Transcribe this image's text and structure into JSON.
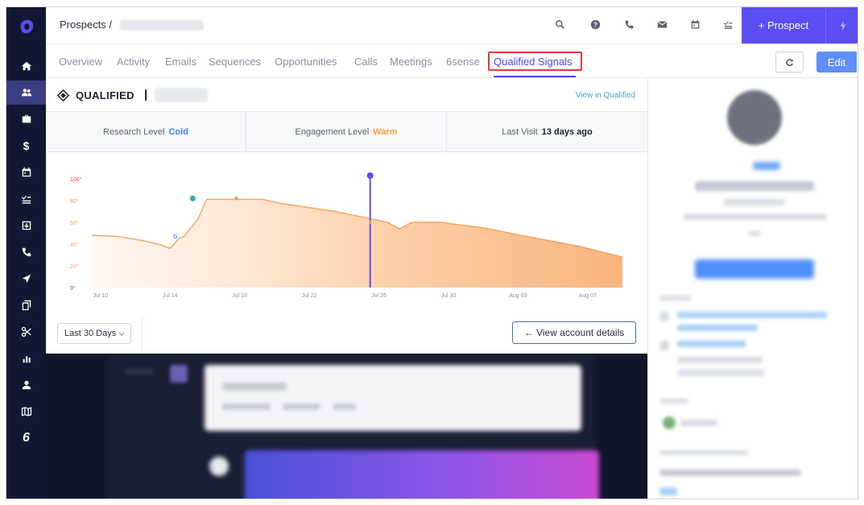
{
  "app": {
    "breadcrumb": "Prospects /",
    "logo_icon": "outreach-logo-icon"
  },
  "sidebar": {
    "items": [
      {
        "icon": "home-icon"
      },
      {
        "icon": "people-icon",
        "active": true
      },
      {
        "icon": "briefcase-icon"
      },
      {
        "icon": "dollar-icon",
        "glyph": "$"
      },
      {
        "icon": "calendar-icon"
      },
      {
        "icon": "tasks-icon"
      },
      {
        "icon": "inbox-icon"
      },
      {
        "icon": "phone-icon"
      },
      {
        "icon": "send-icon"
      },
      {
        "icon": "copy-icon"
      },
      {
        "icon": "scissors-icon"
      },
      {
        "icon": "bar-chart-icon"
      },
      {
        "icon": "user-icon"
      },
      {
        "icon": "map-icon"
      },
      {
        "icon": "number-six-icon",
        "glyph": "6"
      }
    ]
  },
  "header": {
    "prospect_button": "+ Prospect",
    "icons": [
      "search-icon",
      "help-icon",
      "phone-icon",
      "mail-icon",
      "calendar-icon",
      "tasks-icon"
    ]
  },
  "tabs": [
    {
      "label": "Overview"
    },
    {
      "label": "Activity"
    },
    {
      "label": "Emails"
    },
    {
      "label": "Sequences"
    },
    {
      "label": "Opportunities"
    },
    {
      "label": "Calls"
    },
    {
      "label": "Meetings"
    },
    {
      "label": "6sense"
    },
    {
      "label": "Qualified Signals",
      "active": true
    }
  ],
  "actions": {
    "edit_label": "Edit"
  },
  "qualified": {
    "title": "QUALIFIED",
    "separator": "|",
    "view_link": "View in Qualified",
    "research_label": "Research Level",
    "research_value": "Cold",
    "engagement_label": "Engagement Level",
    "engagement_value": "Warm",
    "last_visit_label": "Last Visit",
    "last_visit_value": "13 days ago",
    "colors": {
      "cold": "#3b82f6",
      "warm": "#f59e3b",
      "accent": "#5c4df5"
    }
  },
  "chart_data": {
    "type": "area",
    "title": "",
    "xlabel": "",
    "ylabel": "",
    "ylim": [
      0,
      100
    ],
    "y_ticks": [
      "0°",
      "20°",
      "40°",
      "60°",
      "80°",
      "100°"
    ],
    "x_ticks": [
      "Jul 10",
      "Jul 14",
      "Jul 18",
      "Jul 22",
      "Jul 26",
      "Jul 30",
      "Aug 03",
      "Aug 07"
    ],
    "x_domain": [
      0,
      30.5
    ],
    "series": [
      {
        "color": "#f5a25d",
        "points": [
          [
            0,
            48
          ],
          [
            1.5,
            47
          ],
          [
            3,
            43
          ],
          [
            4,
            39
          ],
          [
            4.5,
            36
          ],
          [
            5,
            45
          ],
          [
            5.3,
            47
          ],
          [
            5.7,
            55
          ],
          [
            6.1,
            63
          ],
          [
            6.3,
            70
          ],
          [
            6.6,
            81
          ],
          [
            8,
            81
          ],
          [
            9.2,
            81
          ],
          [
            9.8,
            81
          ],
          [
            11,
            77
          ],
          [
            14,
            70
          ],
          [
            17,
            60
          ],
          [
            17.7,
            54
          ],
          [
            18.4,
            60
          ],
          [
            20,
            60
          ],
          [
            22.5,
            55
          ],
          [
            25,
            47
          ],
          [
            28,
            38
          ],
          [
            30.5,
            28
          ]
        ]
      }
    ],
    "markers": [
      {
        "x": 4.8,
        "y": 47,
        "label": "G",
        "icon": "google-icon"
      },
      {
        "x": 5.8,
        "y": 82,
        "icon": "qualified-icon"
      },
      {
        "x": 8.3,
        "y": 82,
        "icon": "orange-dot"
      }
    ],
    "cursor": {
      "x": 16.0,
      "y": 60,
      "top_value": 100
    }
  },
  "controls": {
    "range_value": "Last 30 Days",
    "account_button": "← View account details"
  }
}
